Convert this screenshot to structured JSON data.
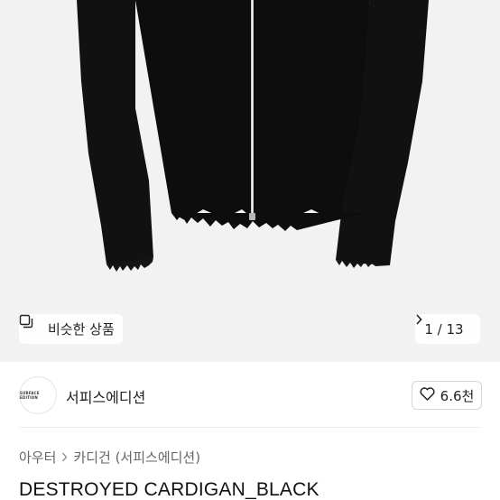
{
  "gallery": {
    "similar_label": "비슷한 상품",
    "page_indicator": "1 / 13"
  },
  "shop": {
    "logo_text": "SURFACE EDITION",
    "name": "서피스에디션",
    "likes": "6.6천"
  },
  "breadcrumb": {
    "level1": "아우터",
    "level2": "카디건 (서피스에디션)"
  },
  "product": {
    "title": "DESTROYED CARDIGAN_BLACK"
  },
  "icons": {
    "similar": "copy-icon",
    "pager_next": "chevron-right-icon",
    "like": "heart-icon",
    "breadcrumb_sep": "chevron-right-icon"
  }
}
